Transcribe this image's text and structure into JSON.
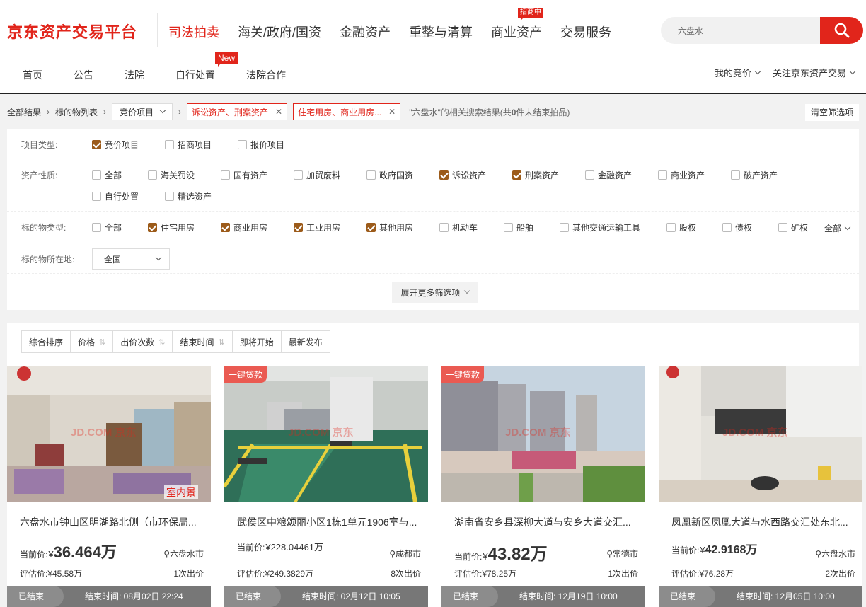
{
  "header": {
    "logo": "京东资产交易平台",
    "main_nav": [
      {
        "label": "司法拍卖",
        "active": true
      },
      {
        "label": "海关/政府/国资"
      },
      {
        "label": "金融资产"
      },
      {
        "label": "重整与清算"
      },
      {
        "label": "商业资产",
        "badge": "招商中"
      },
      {
        "label": "交易服务"
      }
    ],
    "search": {
      "value": "六盘水"
    },
    "sub_nav": [
      {
        "label": "首页"
      },
      {
        "label": "公告"
      },
      {
        "label": "法院"
      },
      {
        "label": "自行处置",
        "badge": "New"
      },
      {
        "label": "法院合作"
      }
    ],
    "user_nav": [
      {
        "label": "我的竞价"
      },
      {
        "label": "关注京东资产交易"
      }
    ],
    "accent": "#e1251b"
  },
  "breadcrumb": {
    "all": "全部结果",
    "list": "标的物列表",
    "select": "竞价项目",
    "tags": [
      "诉讼资产、刑案资产",
      "住宅用房、商业用房..."
    ],
    "result_prefix": "\"六盘水\"的相关搜索结果(共",
    "result_count": "0",
    "result_suffix": "件未结束拍品)",
    "clear": "清空筛选项"
  },
  "filters": {
    "project_type": {
      "label": "项目类型:",
      "options": [
        {
          "label": "竞价项目",
          "checked": true
        },
        {
          "label": "招商项目",
          "checked": false
        },
        {
          "label": "报价项目",
          "checked": false
        }
      ]
    },
    "asset_nature": {
      "label": "资产性质:",
      "options": [
        {
          "label": "全部",
          "checked": false
        },
        {
          "label": "海关罚没",
          "checked": false
        },
        {
          "label": "国有资产",
          "checked": false
        },
        {
          "label": "加贸废料",
          "checked": false
        },
        {
          "label": "政府国资",
          "checked": false
        },
        {
          "label": "诉讼资产",
          "checked": true
        },
        {
          "label": "刑案资产",
          "checked": true
        },
        {
          "label": "金融资产",
          "checked": false
        },
        {
          "label": "商业资产",
          "checked": false
        },
        {
          "label": "破产资产",
          "checked": false
        },
        {
          "label": "自行处置",
          "checked": false
        },
        {
          "label": "精选资产",
          "checked": false
        }
      ]
    },
    "object_type": {
      "label": "标的物类型:",
      "options": [
        {
          "label": "全部",
          "checked": false
        },
        {
          "label": "住宅用房",
          "checked": true
        },
        {
          "label": "商业用房",
          "checked": true
        },
        {
          "label": "工业用房",
          "checked": true
        },
        {
          "label": "其他用房",
          "checked": true
        },
        {
          "label": "机动车",
          "checked": false
        },
        {
          "label": "船舶",
          "checked": false
        },
        {
          "label": "其他交通运输工具",
          "checked": false
        },
        {
          "label": "股权",
          "checked": false
        },
        {
          "label": "债权",
          "checked": false
        },
        {
          "label": "矿权",
          "checked": false
        }
      ],
      "all_toggle": "全部"
    },
    "location": {
      "label": "标的物所在地:",
      "value": "全国"
    },
    "more": "展开更多筛选项"
  },
  "sort": [
    {
      "label": "综合排序"
    },
    {
      "label": "价格",
      "arrow": true
    },
    {
      "label": "出价次数",
      "arrow": true
    },
    {
      "label": "结束时间",
      "arrow": true
    },
    {
      "label": "即将开始"
    },
    {
      "label": "最新发布"
    }
  ],
  "price_label": "当前价:",
  "currency": "¥",
  "items": [
    {
      "title": "六盘水市钟山区明湖路北侧（市环保局...",
      "price": "36.464万",
      "price_big": true,
      "city": "六盘水市",
      "estimate": "评估价:¥45.58万",
      "bids": "1次出价",
      "status": "已结束",
      "end_time": "结束时间: 08月02日 22:24",
      "badge": "",
      "corner": "室内景",
      "watermark": "JD.COM 京东"
    },
    {
      "title": "武侯区中粮颂丽小区1栋1单元1906室与...",
      "price": "228.04461万",
      "price_big": false,
      "city": "成都市",
      "estimate": "评估价:¥249.3829万",
      "bids": "8次出价",
      "status": "已结束",
      "end_time": "结束时间: 02月12日 10:05",
      "badge": "一键贷款",
      "corner": "",
      "watermark": "JD.COM 京东"
    },
    {
      "title": "湖南省安乡县深柳大道与安乡大道交汇...",
      "price": "43.82万",
      "price_big": true,
      "city": "常德市",
      "estimate": "评估价:¥78.25万",
      "bids": "1次出价",
      "status": "已结束",
      "end_time": "结束时间: 12月19日 10:00",
      "badge": "一键贷款",
      "corner": "",
      "watermark": "JD.COM 京东"
    },
    {
      "title": "凤凰新区凤凰大道与水西路交汇处东北...",
      "price": "42.9168万",
      "price_big": false,
      "city": "六盘水市",
      "estimate": "评估价:¥76.28万",
      "bids": "2次出价",
      "status": "已结束",
      "end_time": "结束时间: 12月05日 10:00",
      "badge": "",
      "corner": "",
      "watermark": "JD.COM 京东"
    }
  ]
}
